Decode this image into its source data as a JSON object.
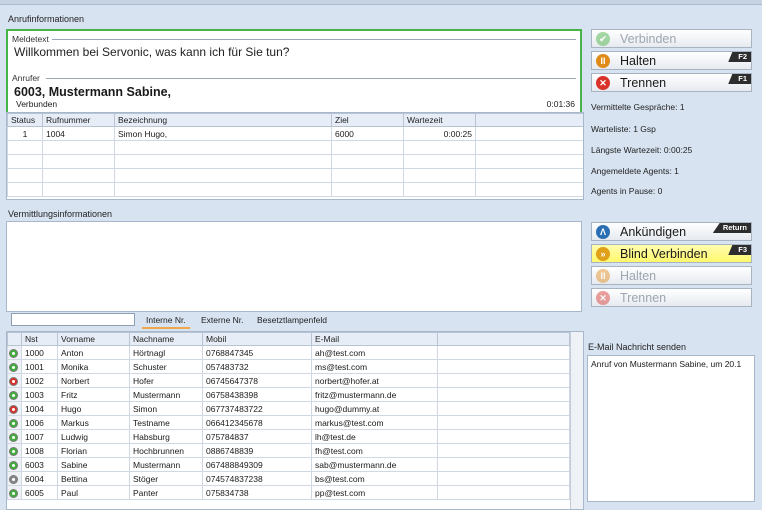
{
  "sections": {
    "call_info": "Anrufinformationen",
    "routing_info": "Vermittlungsinformationen",
    "email_send": "E-Mail Nachricht senden"
  },
  "caller": {
    "message_label": "Meldetext",
    "message": "Willkommen bei Servonic, was kann ich für Sie tun?",
    "caller_label": "Anrufer",
    "caller_name": "6003, Mustermann Sabine,",
    "status": "Verbunden",
    "duration": "0:01:36"
  },
  "queue_table": {
    "columns": [
      "Status",
      "Rufnummer",
      "Bezeichnung",
      "Ziel",
      "Wartezeit"
    ],
    "rows": [
      [
        "1",
        "1004",
        "Simon Hugo,",
        "6000",
        "0:00:25"
      ]
    ]
  },
  "buttons_top": [
    {
      "label": "Verbinden",
      "key": "",
      "icon": "check-icon",
      "disabled": true
    },
    {
      "label": "Halten",
      "key": "F2",
      "icon": "pause-icon",
      "disabled": false
    },
    {
      "label": "Trennen",
      "key": "F1",
      "icon": "close-icon",
      "disabled": false
    }
  ],
  "stats": {
    "forwarded": "Vermittelte Gespräche: 1",
    "queue": "Warteliste: 1 Gsp",
    "longest_wait": "Längste Wartezeit: 0:00:25",
    "agents_logged": "Angemeldete Agents: 1",
    "agents_pause": "Agents in Pause: 0"
  },
  "buttons_bottom": [
    {
      "label": "Ankündigen",
      "key": "Return",
      "icon": "announce-icon",
      "disabled": false,
      "highlight": false
    },
    {
      "label": "Blind Verbinden",
      "key": "F3",
      "icon": "forward-icon",
      "disabled": false,
      "highlight": true
    },
    {
      "label": "Halten",
      "key": "",
      "icon": "pause-icon",
      "disabled": true,
      "highlight": false
    },
    {
      "label": "Trennen",
      "key": "",
      "icon": "close-icon",
      "disabled": true,
      "highlight": false
    }
  ],
  "tabs": [
    "Interne Nr.",
    "Externe Nr.",
    "Besetztlampenfeld"
  ],
  "search": {
    "value": ""
  },
  "directory": {
    "columns": [
      "Nst",
      "Vorname",
      "Nachname",
      "Mobil",
      "E-Mail"
    ],
    "rows": [
      {
        "status": "green",
        "nst": "1000",
        "first": "Anton",
        "last": "Hörtnagl",
        "mobile": "0768847345",
        "email": "ah@test.com"
      },
      {
        "status": "green",
        "nst": "1001",
        "first": "Monika",
        "last": "Schuster",
        "mobile": "057483732",
        "email": "ms@test.com"
      },
      {
        "status": "red",
        "nst": "1002",
        "first": "Norbert",
        "last": "Hofer",
        "mobile": "06745647378",
        "email": "norbert@hofer.at"
      },
      {
        "status": "green",
        "nst": "1003",
        "first": "Fritz",
        "last": "Mustermann",
        "mobile": "06758438398",
        "email": "fritz@mustermann.de"
      },
      {
        "status": "red",
        "nst": "1004",
        "first": "Hugo",
        "last": "Simon",
        "mobile": "067737483722",
        "email": "hugo@dummy.at"
      },
      {
        "status": "green",
        "nst": "1006",
        "first": "Markus",
        "last": "Testname",
        "mobile": "066412345678",
        "email": "markus@test.com"
      },
      {
        "status": "green",
        "nst": "1007",
        "first": "Ludwig",
        "last": "Habsburg",
        "mobile": "075784837",
        "email": "lh@test.de"
      },
      {
        "status": "green",
        "nst": "1008",
        "first": "Florian",
        "last": "Hochbrunnen",
        "mobile": "0886748839",
        "email": "fh@test.com"
      },
      {
        "status": "green",
        "nst": "6003",
        "first": "Sabine",
        "last": "Mustermann",
        "mobile": "067488849309",
        "email": "sab@mustermann.de"
      },
      {
        "status": "gray",
        "nst": "6004",
        "first": "Bettina",
        "last": "Stöger",
        "mobile": "074574837238",
        "email": "bs@test.com"
      },
      {
        "status": "green",
        "nst": "6005",
        "first": "Paul",
        "last": "Panter",
        "mobile": "075834738",
        "email": "pp@test.com"
      }
    ]
  },
  "email": {
    "body": "Anruf von Mustermann Sabine,  um 20.1"
  },
  "colors": {
    "background": "#d7e3f1",
    "caller_border": "#46b34b",
    "highlight_button": "#fff86b",
    "key_badge": "#2d2d2d"
  }
}
